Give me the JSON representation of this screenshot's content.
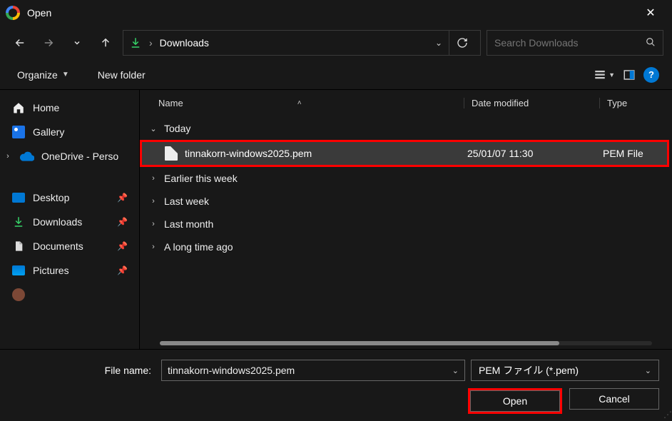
{
  "titlebar": {
    "title": "Open"
  },
  "nav": {},
  "address": {
    "location": "Downloads"
  },
  "search": {
    "placeholder": "Search Downloads"
  },
  "toolbar": {
    "organize": "Organize",
    "newfolder": "New folder"
  },
  "sidebar": {
    "home": "Home",
    "gallery": "Gallery",
    "onedrive": "OneDrive - Perso",
    "desktop": "Desktop",
    "downloads": "Downloads",
    "documents": "Documents",
    "pictures": "Pictures"
  },
  "columns": {
    "name": "Name",
    "modified": "Date modified",
    "type": "Type"
  },
  "groups": {
    "today": "Today",
    "earlier": "Earlier this week",
    "lastweek": "Last week",
    "lastmonth": "Last month",
    "longago": "A long time ago"
  },
  "file": {
    "name": "tinnakorn-windows2025.pem",
    "modified": "25/01/07 11:30",
    "type": "PEM File"
  },
  "bottom": {
    "label": "File name:",
    "value": "tinnakorn-windows2025.pem",
    "filter": "PEM ファイル (*.pem)",
    "open": "Open",
    "cancel": "Cancel"
  }
}
